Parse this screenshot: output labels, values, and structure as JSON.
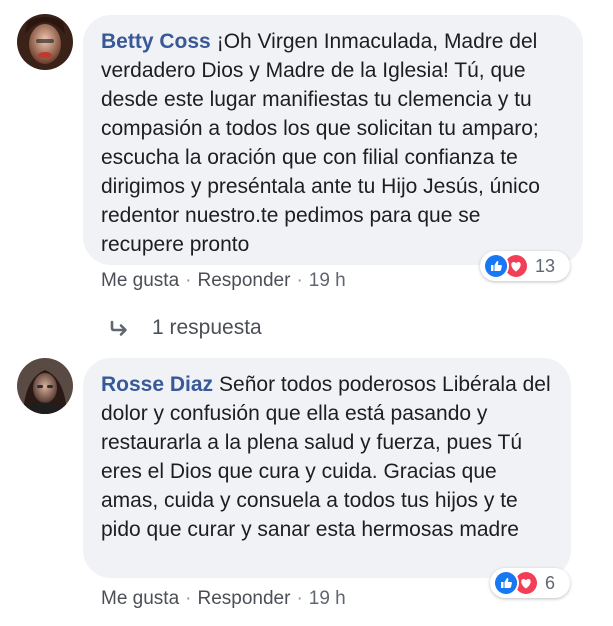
{
  "comments": [
    {
      "author": "Betty Coss",
      "text": "¡Oh Virgen Inmaculada, Madre del verdadero Dios y Madre de la Iglesia! Tú, que desde este lugar manifiestas tu clemencia y tu compasión a todos los que solicitan tu amparo; escucha la oración que con filial confianza te dirigimos y preséntala ante tu Hijo Jesús, único redentor nuestro.te pedimos para que se recupere pronto",
      "like_label": "Me gusta",
      "reply_label": "Responder",
      "time": "19 h",
      "reaction_count": "13"
    },
    {
      "author": "Rosse Diaz",
      "text": "Señor todos poderosos Libérala del dolor y confusión que ella está pasando y restaurarla a la plena salud y fuerza, pues Tú eres el Dios que cura y cuida. Gracias que amas, cuida y consuela a todos tus hijos y te pido que curar y sanar esta hermosas madre",
      "like_label": "Me gusta",
      "reply_label": "Responder",
      "time": "19 h",
      "reaction_count": "6"
    }
  ],
  "replies_link": "1 respuesta",
  "separator": "·",
  "colors": {
    "author": "#385898",
    "bubble": "#f0f2f5",
    "like": "#1877f2",
    "love": "#f33e58"
  },
  "icons": [
    "like-reaction-icon",
    "love-reaction-icon",
    "reply-arrow-icon"
  ]
}
